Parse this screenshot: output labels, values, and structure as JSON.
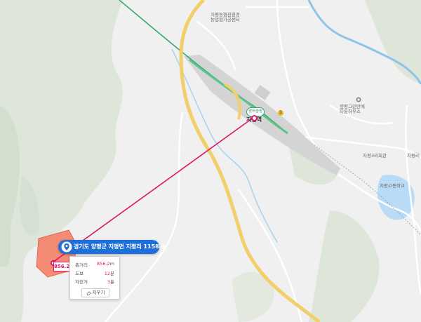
{
  "map": {
    "labels": {
      "agri_center": "지평농협친환경",
      "agri_center_2": "농업협가공센터",
      "station_tag": "경의중앙",
      "station_name": "지평역",
      "greenland": "양평그린만에",
      "greenland_2": "티운하우스",
      "community_hall": "지평3리회관",
      "high_school": "지평고등학교",
      "poi_suffix": "지평리"
    },
    "line_badge": "1",
    "colors": {
      "route": "#e0146a",
      "rail_green": "#2eaa6a",
      "road_yellow": "#f2cf6b",
      "water": "#8fc4ea",
      "parcel_fill": "#f4836b",
      "bubble_blue": "#1e6fd9"
    }
  },
  "measure": {
    "address": "경기도 양평군 지평면 지평리 1158-4",
    "distance_label": "856.2m",
    "rows": {
      "total_label": "총거리",
      "total_value": "856.2",
      "total_unit": "m",
      "walk_label": "도보",
      "walk_value": "12",
      "walk_unit": "분",
      "bike_label": "자전거",
      "bike_value": "3",
      "bike_unit": "분"
    },
    "clear_label": "지우기"
  }
}
